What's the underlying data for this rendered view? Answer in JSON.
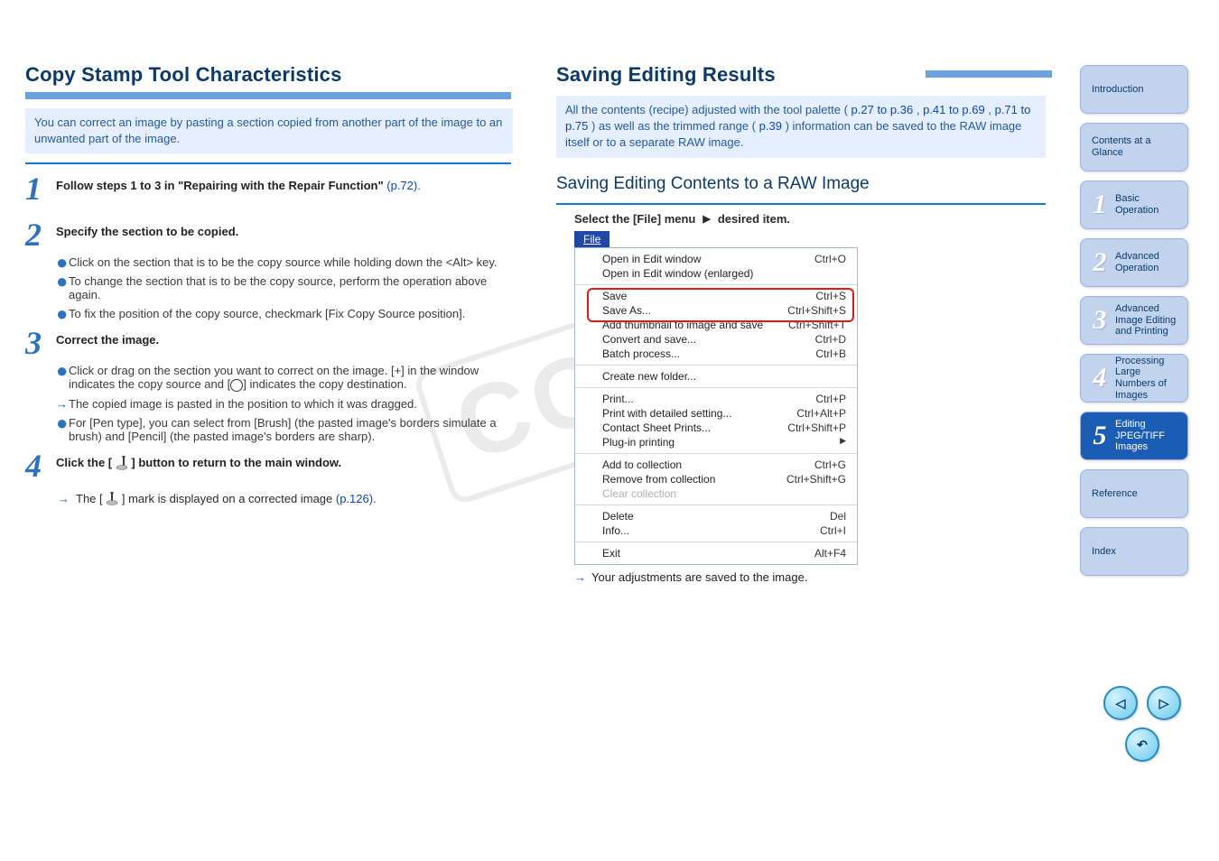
{
  "watermark": "COPY",
  "title_left": "Copy Stamp Tool Characteristics",
  "lightbox_left": "You can correct an image by pasting a section copied from another part of the image to an unwanted part of the image.",
  "steps": {
    "s1_head": "Follow steps 1 to 3 in \"Repairing with the Repair Function\"",
    "s1_ref": "(p.72).",
    "s2_head": "Specify the section to be copied.",
    "s2_b1": "Click on the section that is to be the copy source while holding down the <Alt> key.",
    "s2_b2": "To change the section that is to be the copy source, perform the operation above again.",
    "s2_b3_a": "To fix the position of the copy source, checkmark ",
    "s2_b3_b": "[Fix Copy Source position].",
    "s3_head": "Correct the image.",
    "s3_b1_a": "Click or drag on the section you want to correct on the image. [",
    "s3_b1_b": "+",
    "s3_b1_c": "] in the window indicates the copy source and [",
    "s3_b1_d": "] indicates the copy destination.",
    "s3_arrow": "The copied image is pasted in the position to which it was dragged.",
    "s3_b2_a": "For [Pen type], you can select from [Brush] (the pasted image's borders simulate a brush) and [Pencil] (the pasted image's borders are sharp).",
    "s4_head_a": "Click the [",
    "s4_head_b": "] button to return to the main window.",
    "s4_arrow_a": "The [",
    "s4_arrow_b": "] mark is displayed on a corrected image ",
    "s4_arrow_ref": "(p.126)."
  },
  "title_right": "Saving Editing Results",
  "lightbox_right": "All the contents (recipe) adjusted with the tool palette (p.27 to p.36, p.41 to p.69, p.71 to p.75) as well as the trimmed range (p.39) information can be saved to the RAW image itself or to a separate RAW image.",
  "lightbox_right_a": "All the contents (recipe) adjusted with the tool palette (",
  "lightbox_right_b": ", ",
  "lightbox_right_c": ", ",
  "lightbox_right_d": ") as well as the trimmed range (",
  "lightbox_right_e": ") information can be saved to the RAW image itself or to a separate RAW image.",
  "right_heading": "Saving Editing Contents to a RAW Image",
  "menu_label": "Select the [File] menu ",
  "menu_tri": "▶",
  "menu_after": " desired item.",
  "file_title": "File",
  "file_menu": {
    "g1": [
      {
        "label": "Open in Edit window",
        "kb": "Ctrl+O"
      },
      {
        "label": "Open in Edit window (enlarged)",
        "kb": ""
      }
    ],
    "g2": [
      {
        "label": "Save",
        "kb": "Ctrl+S"
      },
      {
        "label": "Save As...",
        "kb": "Ctrl+Shift+S"
      },
      {
        "label": "Add thumbnail to image and save",
        "kb": "Ctrl+Shift+T"
      },
      {
        "label": "Convert and save...",
        "kb": "Ctrl+D"
      },
      {
        "label": "Batch process...",
        "kb": "Ctrl+B"
      }
    ],
    "g3": [
      {
        "label": "Create new folder...",
        "kb": ""
      }
    ],
    "g4": [
      {
        "label": "Print...",
        "kb": "Ctrl+P"
      },
      {
        "label": "Print with detailed setting...",
        "kb": "Ctrl+Alt+P"
      },
      {
        "label": "Contact Sheet Prints...",
        "kb": "Ctrl+Shift+P"
      },
      {
        "label": "Plug-in printing",
        "kb": "",
        "sub": true
      }
    ],
    "g5": [
      {
        "label": "Add to collection",
        "kb": "Ctrl+G"
      },
      {
        "label": "Remove from collection",
        "kb": "Ctrl+Shift+G"
      },
      {
        "label": "Clear collection",
        "kb": "",
        "disabled": true
      }
    ],
    "g6": [
      {
        "label": "Delete",
        "kb": "Del"
      },
      {
        "label": "Info...",
        "kb": "Ctrl+I"
      }
    ],
    "g7": [
      {
        "label": "Exit",
        "kb": "Alt+F4"
      }
    ]
  },
  "right_arrow": "Your adjustments are saved to the image.",
  "tabs": [
    {
      "label": "Introduction"
    },
    {
      "label": "Contents at a Glance"
    },
    {
      "num": "1",
      "label": "Basic Operation"
    },
    {
      "num": "2",
      "label": "Advanced Operation"
    },
    {
      "num": "3",
      "label": "Advanced Image Editing and Printing"
    },
    {
      "num": "4",
      "label": "Processing Large Numbers of Images"
    },
    {
      "num": "5",
      "label": "Editing JPEG/TIFF Images"
    },
    {
      "label": "Reference"
    },
    {
      "label": "Index"
    }
  ],
  "xrefs": {
    "p27_36": "p.27 to p.36",
    "p41_69": "p.41 to p.69",
    "p71_75": "p.71 to p.75",
    "p39": "p.39"
  }
}
